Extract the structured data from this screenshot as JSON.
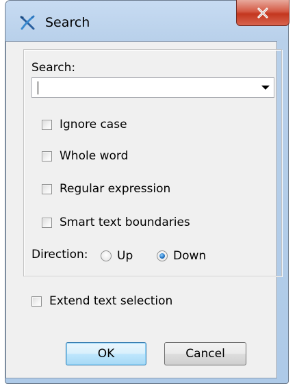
{
  "window": {
    "title": "Search",
    "icon": "crossed-tools-icon",
    "close_icon": "close-icon"
  },
  "search": {
    "label": "Search:",
    "value": "",
    "placeholder": ""
  },
  "options": {
    "ignore_case": {
      "label": "Ignore case",
      "checked": false
    },
    "whole_word": {
      "label": "Whole word",
      "checked": false
    },
    "regex": {
      "label": "Regular expression",
      "checked": false
    },
    "smart_boundaries": {
      "label": "Smart text boundaries",
      "checked": false
    }
  },
  "direction": {
    "label": "Direction:",
    "up_label": "Up",
    "down_label": "Down",
    "selected": "Down"
  },
  "extend_selection": {
    "label": "Extend text selection",
    "checked": false
  },
  "buttons": {
    "ok": "OK",
    "cancel": "Cancel"
  },
  "colors": {
    "close_button": "#c3371f",
    "default_button_border": "#3c7fb1",
    "radio_selected": "#1f6fc0"
  }
}
